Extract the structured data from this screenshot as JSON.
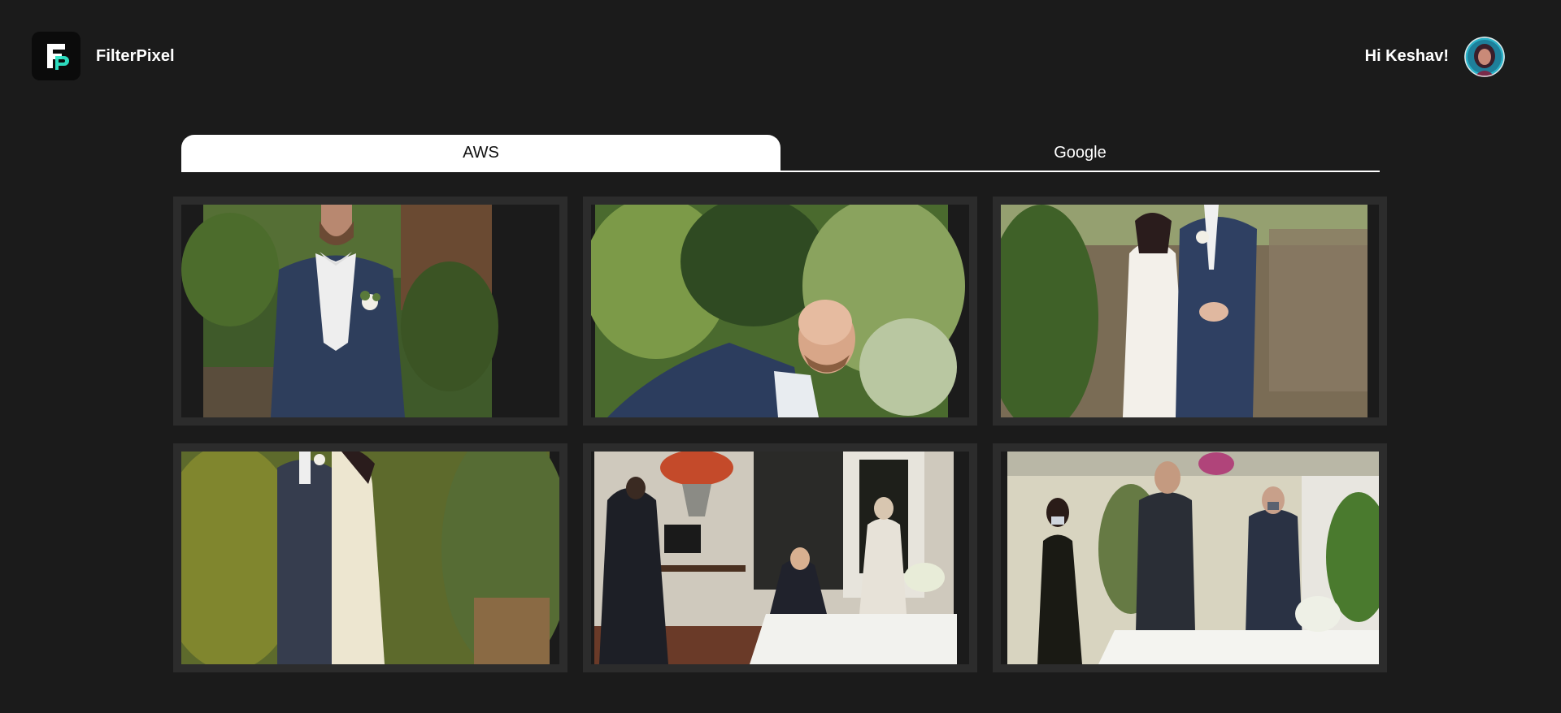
{
  "header": {
    "brand_name": "FilterPixel",
    "greeting": "Hi Keshav!",
    "logo_icon": "filterpixel-logo-icon",
    "avatar_icon": "user-avatar"
  },
  "tabs": [
    {
      "label": "AWS",
      "active": true
    },
    {
      "label": "Google",
      "active": false
    }
  ],
  "gallery": {
    "photos": [
      {
        "subject": "groom-portrait"
      },
      {
        "subject": "groom-leaning"
      },
      {
        "subject": "couple-holding-hands"
      },
      {
        "subject": "couple-standing"
      },
      {
        "subject": "indoor-reception"
      },
      {
        "subject": "patio-guests"
      }
    ]
  },
  "colors": {
    "background": "#1b1b1b",
    "card_border": "#2c2c2c",
    "accent": "#2ee6c7",
    "tab_active_bg": "#ffffff"
  }
}
